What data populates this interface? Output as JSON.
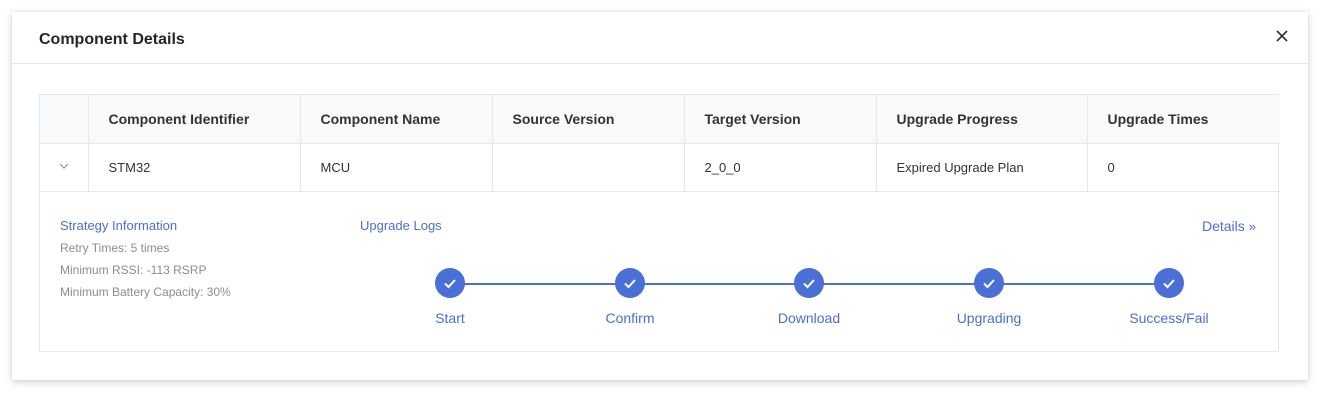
{
  "modal": {
    "title": "Component Details"
  },
  "table": {
    "headers": [
      "Component Identifier",
      "Component Name",
      "Source Version",
      "Target Version",
      "Upgrade Progress",
      "Upgrade Times"
    ],
    "rows": [
      {
        "identifier": "STM32",
        "name": "MCU",
        "source_version": "",
        "target_version": "2_0_0",
        "upgrade_progress": "Expired Upgrade Plan",
        "upgrade_times": "0"
      }
    ]
  },
  "detail": {
    "strategy_link": "Strategy Information",
    "strategy_lines": [
      "Retry Times: 5 times",
      "Minimum RSSI: -113 RSRP",
      "Minimum Battery Capacity: 30%"
    ],
    "logs_link": "Upgrade Logs",
    "details_link": "Details",
    "steps": [
      "Start",
      "Confirm",
      "Download",
      "Upgrading",
      "Success/Fail"
    ]
  },
  "colors": {
    "accent": "#4a6fd6",
    "muted_text": "#8c8c8c",
    "header_bg": "#f8f9fa"
  },
  "icons": {
    "close": "close-icon",
    "expand": "chevron-down-icon",
    "step": "check-icon",
    "details": "double-chevron-right-icon"
  }
}
